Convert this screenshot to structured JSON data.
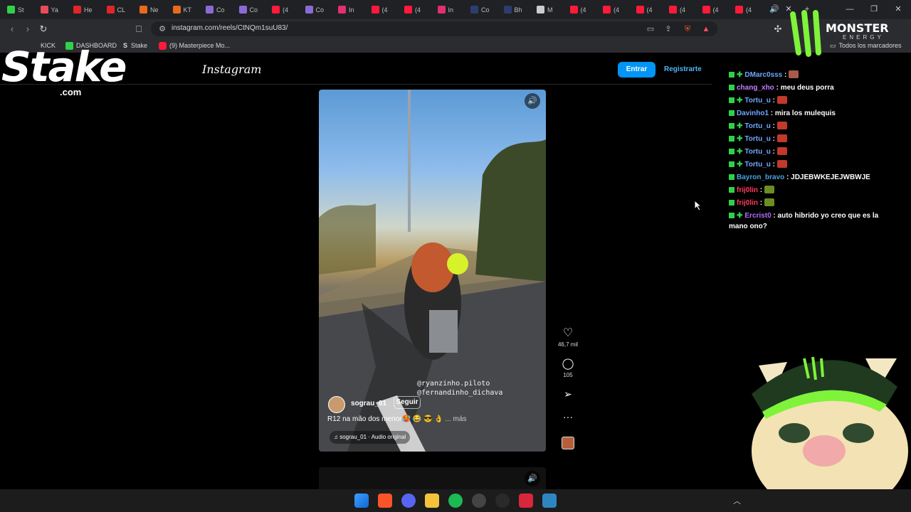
{
  "tabs": [
    {
      "label": "St",
      "color": "#2fd14b"
    },
    {
      "label": "Ya",
      "color": "#e84b5a"
    },
    {
      "label": "He",
      "color": "#e0262a"
    },
    {
      "label": "CL",
      "color": "#e0262a"
    },
    {
      "label": "Ne",
      "color": "#e86a1c"
    },
    {
      "label": "KT",
      "color": "#e86a1c"
    },
    {
      "label": "Co",
      "color": "#8a6bd6"
    },
    {
      "label": "Co",
      "color": "#8a6bd6"
    },
    {
      "label": "(4",
      "color": "#ff1a3a"
    },
    {
      "label": "Co",
      "color": "#8a6bd6"
    },
    {
      "label": "In",
      "color": "#e1306c"
    },
    {
      "label": "(4",
      "color": "#ff1a3a"
    },
    {
      "label": "(4",
      "color": "#ff1a3a"
    },
    {
      "label": "In",
      "color": "#e1306c"
    },
    {
      "label": "Co",
      "color": "#2c3e6e"
    },
    {
      "label": "Bh",
      "color": "#2c3e6e"
    },
    {
      "label": "M",
      "color": "#cccccc"
    },
    {
      "label": "(4",
      "color": "#ff1a3a"
    },
    {
      "label": "(4",
      "color": "#ff1a3a"
    },
    {
      "label": "(4",
      "color": "#ff1a3a"
    },
    {
      "label": "(4",
      "color": "#ff1a3a"
    },
    {
      "label": "(4",
      "color": "#ff1a3a"
    },
    {
      "label": "(4",
      "color": "#ff1a3a"
    }
  ],
  "address_bar": {
    "url": "instagram.com/reels/CtNQm1suU83/"
  },
  "bookmarks": [
    {
      "label": "KICK",
      "color": "#2fd14b"
    },
    {
      "label": "DASHBOARD",
      "color": "#2fd14b"
    },
    {
      "label": "Stake",
      "color": "#cfcfcf"
    },
    {
      "label": "(9) Masterpiece Mo...",
      "color": "#ff1a3a"
    }
  ],
  "bookmarks_all": "Todos los marcadores",
  "instagram": {
    "logo": "Instagram",
    "login": "Entrar",
    "signup": "Registrarte",
    "reel": {
      "username": "sograu_01",
      "follow": "Seguir",
      "caption": "R12 na mão dos menor🥵 😂 😎 👌",
      "more": "... más",
      "audio": "sograu_01 · Audio original",
      "watermark_1": "@ryanzinho.piloto",
      "watermark_2": "@fernandinho_dichava",
      "likes": "46,7 mil",
      "comments": "105"
    }
  },
  "overlay": {
    "stake_word": "Stake",
    "stake_com": ".com",
    "monster_word": "MONSTER",
    "monster_sub": "ENERGY"
  },
  "chat": [
    {
      "user": "DMarc0sss",
      "text": "",
      "color": "#6fa8ff",
      "emote": "#a85a4a"
    },
    {
      "user": "chang_xho",
      "text": "meu deus porra",
      "color": "#c77dff",
      "emote": ""
    },
    {
      "user": "Tortu_u",
      "text": "",
      "color": "#6fa8ff",
      "emote": "#c0392b"
    },
    {
      "user": "Davinho1",
      "text": "mira los mulequis",
      "color": "#6fa8ff",
      "emote": ""
    },
    {
      "user": "Tortu_u",
      "text": "",
      "color": "#6fa8ff",
      "emote": "#c0392b"
    },
    {
      "user": "Tortu_u",
      "text": "",
      "color": "#6fa8ff",
      "emote": "#c0392b"
    },
    {
      "user": "Tortu_u",
      "text": "",
      "color": "#6fa8ff",
      "emote": "#c0392b"
    },
    {
      "user": "Tortu_u",
      "text": "",
      "color": "#6fa8ff",
      "emote": "#c0392b"
    },
    {
      "user": "Bayron_bravo",
      "text": "JDJEBWKEJEJWBWJE",
      "color": "#4aa3df",
      "emote": ""
    },
    {
      "user": "frij0lin",
      "text": "",
      "color": "#ff3b5c",
      "emote": "#6b8e23"
    },
    {
      "user": "frij0lin",
      "text": "",
      "color": "#ff3b5c",
      "emote": "#6b8e23"
    },
    {
      "user": "Ercrist0",
      "text": "auto hibrido yo creo que es la mano ono?",
      "color": "#b06bff",
      "emote": ""
    }
  ]
}
